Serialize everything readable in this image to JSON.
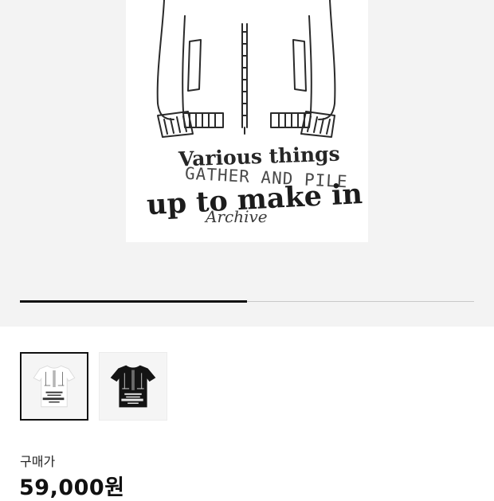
{
  "gallery": {
    "main_image_alt": "product-image",
    "print_lines": [
      "Various things",
      "GATHER AND PILE",
      "up to make in",
      "Archive"
    ],
    "progress": 0.5,
    "thumbnails": [
      {
        "variant": "white",
        "selected": true
      },
      {
        "variant": "black",
        "selected": false
      }
    ]
  },
  "purchase": {
    "label": "구매가",
    "price": "59,000원"
  },
  "colors": {
    "hero_background": "#f3f3f3",
    "accent": "#111111"
  }
}
